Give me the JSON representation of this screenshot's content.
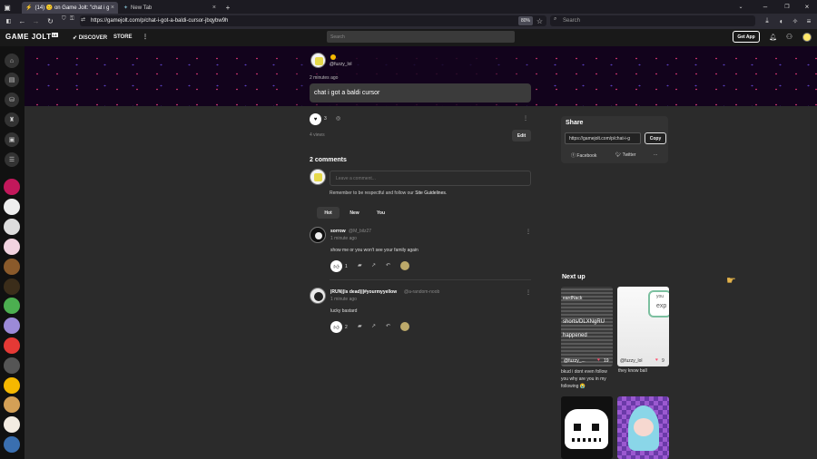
{
  "browser": {
    "tabs": [
      {
        "label": "(14) 🙁 on Game Jolt: \"chat i go…"
      },
      {
        "label": "New Tab"
      }
    ],
    "url": "https://gamejolt.com/p/chat-i-got-a-baldi-cursor-jbqybw9h",
    "zoom": "80%",
    "search_placeholder": "Search"
  },
  "site": {
    "logo": "GAME JOLT",
    "logo_badge": "14",
    "nav": {
      "discover": "DISCOVER",
      "store": "STORE"
    },
    "search_placeholder": "Search",
    "get_app": "Get App"
  },
  "post": {
    "author_handle": "@fuzzy_lol",
    "time": "2 minutes ago",
    "text": "chat i got a baldi cursor",
    "likes": "3",
    "views": "4 views",
    "edit_label": "Edit"
  },
  "share": {
    "title": "Share",
    "link": "https://gamejolt.com/p/chat-i-g",
    "copy_label": "Copy",
    "facebook": "Facebook",
    "twitter": "Twitter",
    "more": "..."
  },
  "comments": {
    "heading": "2 comments",
    "input_placeholder": "Leave a comment...",
    "guidelines_prefix": "Remember to be respectful and follow our ",
    "guidelines_link": "Site Guidelines",
    "guidelines_suffix": ".",
    "sorts": [
      "Hot",
      "New",
      "You"
    ],
    "items": [
      {
        "name": "sorrow",
        "handle": "@M_bilz27",
        "time": "1 minute ago",
        "text": "show me or you won't see your family again",
        "likes": "1"
      },
      {
        "name": "|RUN|(is dead)||#yourmyyellow",
        "handle": "@a-random-noob",
        "time": "1 minute ago",
        "text": "lucky bastard",
        "likes": "2"
      }
    ]
  },
  "next_up": {
    "title": "Next up",
    "cards": [
      {
        "overlay_lines": [
          "eardNack",
          "shorts/DLXNgRU",
          "happened"
        ],
        "user": "@fuzzy_...",
        "likes": "19",
        "caption": "bkud i dont even follow you why are you in my following 😭"
      },
      {
        "overlay_lines": [
          "you",
          "exp"
        ],
        "user": "@fuzzy_lol",
        "likes": "9",
        "caption": "they know ball"
      },
      {
        "overlay_lines": [],
        "user": "",
        "likes": "",
        "caption": ""
      },
      {
        "overlay_lines": [],
        "user": "",
        "likes": "",
        "caption": ""
      }
    ]
  },
  "colors": {
    "accent_green": "#6bda6b",
    "heart": "#ff4d6d",
    "banner_bg": "#12031c"
  }
}
